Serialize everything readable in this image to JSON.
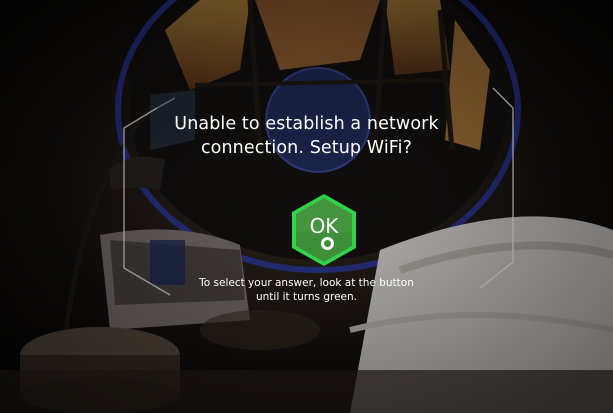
{
  "dialog": {
    "prompt_lines": [
      "Unable to establish a network",
      "connection. Setup WiFi?"
    ],
    "hint_lines": [
      "To select your answer, look at the button",
      "until it turns green."
    ]
  },
  "ok_button": {
    "label": "OK",
    "state": "gaze-selected",
    "fill_color": "#3f8f3a",
    "progress_ring_color": "#2fd44a"
  },
  "colors": {
    "frame": "#a9a9a9",
    "text": "#ffffff",
    "window_glow": "#3b4fd1"
  }
}
